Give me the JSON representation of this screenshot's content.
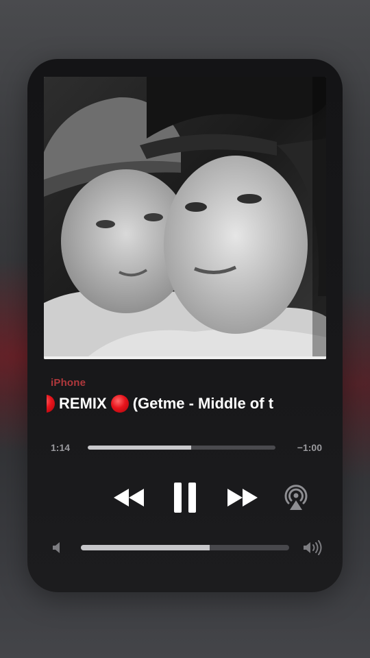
{
  "now_playing": {
    "source": "iPhone",
    "title_text": "REMIX",
    "title_tail": "(Getme  - Middle of t",
    "artwork_icon": "album-artwork-photo"
  },
  "progress": {
    "elapsed": "1:14",
    "remaining": "−1:00",
    "fraction": 0.55
  },
  "controls": {
    "rewind_icon": "rewind-icon",
    "pause_icon": "pause-icon",
    "forward_icon": "fast-forward-icon",
    "airplay_icon": "airplay-audio-icon"
  },
  "volume": {
    "level": 0.62,
    "low_icon": "speaker-low-icon",
    "high_icon": "speaker-high-icon"
  },
  "colors": {
    "source_label": "#b0383c",
    "record_dot": "#e8141c",
    "progress_fill": "#c9c9cc",
    "track": "#4a4a4e"
  }
}
